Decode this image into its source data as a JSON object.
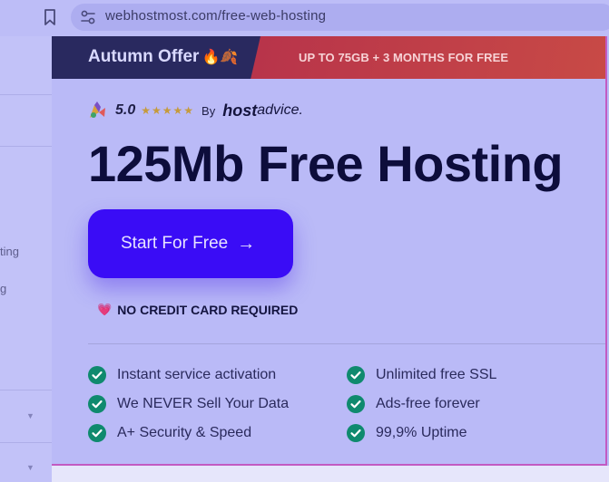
{
  "browser": {
    "url": "webhostmost.com/free-web-hosting"
  },
  "sidebar": {
    "items": [
      {
        "label": "ting"
      },
      {
        "label": "g"
      }
    ]
  },
  "banner": {
    "offer_label": "Autumn Offer",
    "offer_emoji": "🔥🍂",
    "promo_text": "UP TO 75GB + 3 MONTHS FOR FREE"
  },
  "rating": {
    "score": "5.0",
    "stars": "★★★★★",
    "by_label": "By",
    "brand_bold": "host",
    "brand_light": "advice."
  },
  "hero": {
    "headline": "125Mb Free Hosting",
    "cta_label": "Start For Free",
    "cta_arrow": "→",
    "no_credit_card": "NO CREDIT CARD REQUIRED",
    "heart_emoji": "💗"
  },
  "features": [
    {
      "label": "Instant service activation"
    },
    {
      "label": "Unlimited free SSL"
    },
    {
      "label": "We NEVER Sell Your Data"
    },
    {
      "label": "Ads-free forever"
    },
    {
      "label": "A+ Security & Speed"
    },
    {
      "label": "99,9% Uptime"
    }
  ],
  "colors": {
    "accent": "#3a0cf6",
    "banner_dark": "#29295f",
    "banner_red": "#c84a46",
    "check_green": "#0f8a6e",
    "headline": "#0d0d3b"
  },
  "icons": {
    "bookmark": "bookmark-icon",
    "site_settings": "site-settings-icon",
    "rating_logo": "rating-mascot-icon",
    "check": "check-circle-icon"
  }
}
